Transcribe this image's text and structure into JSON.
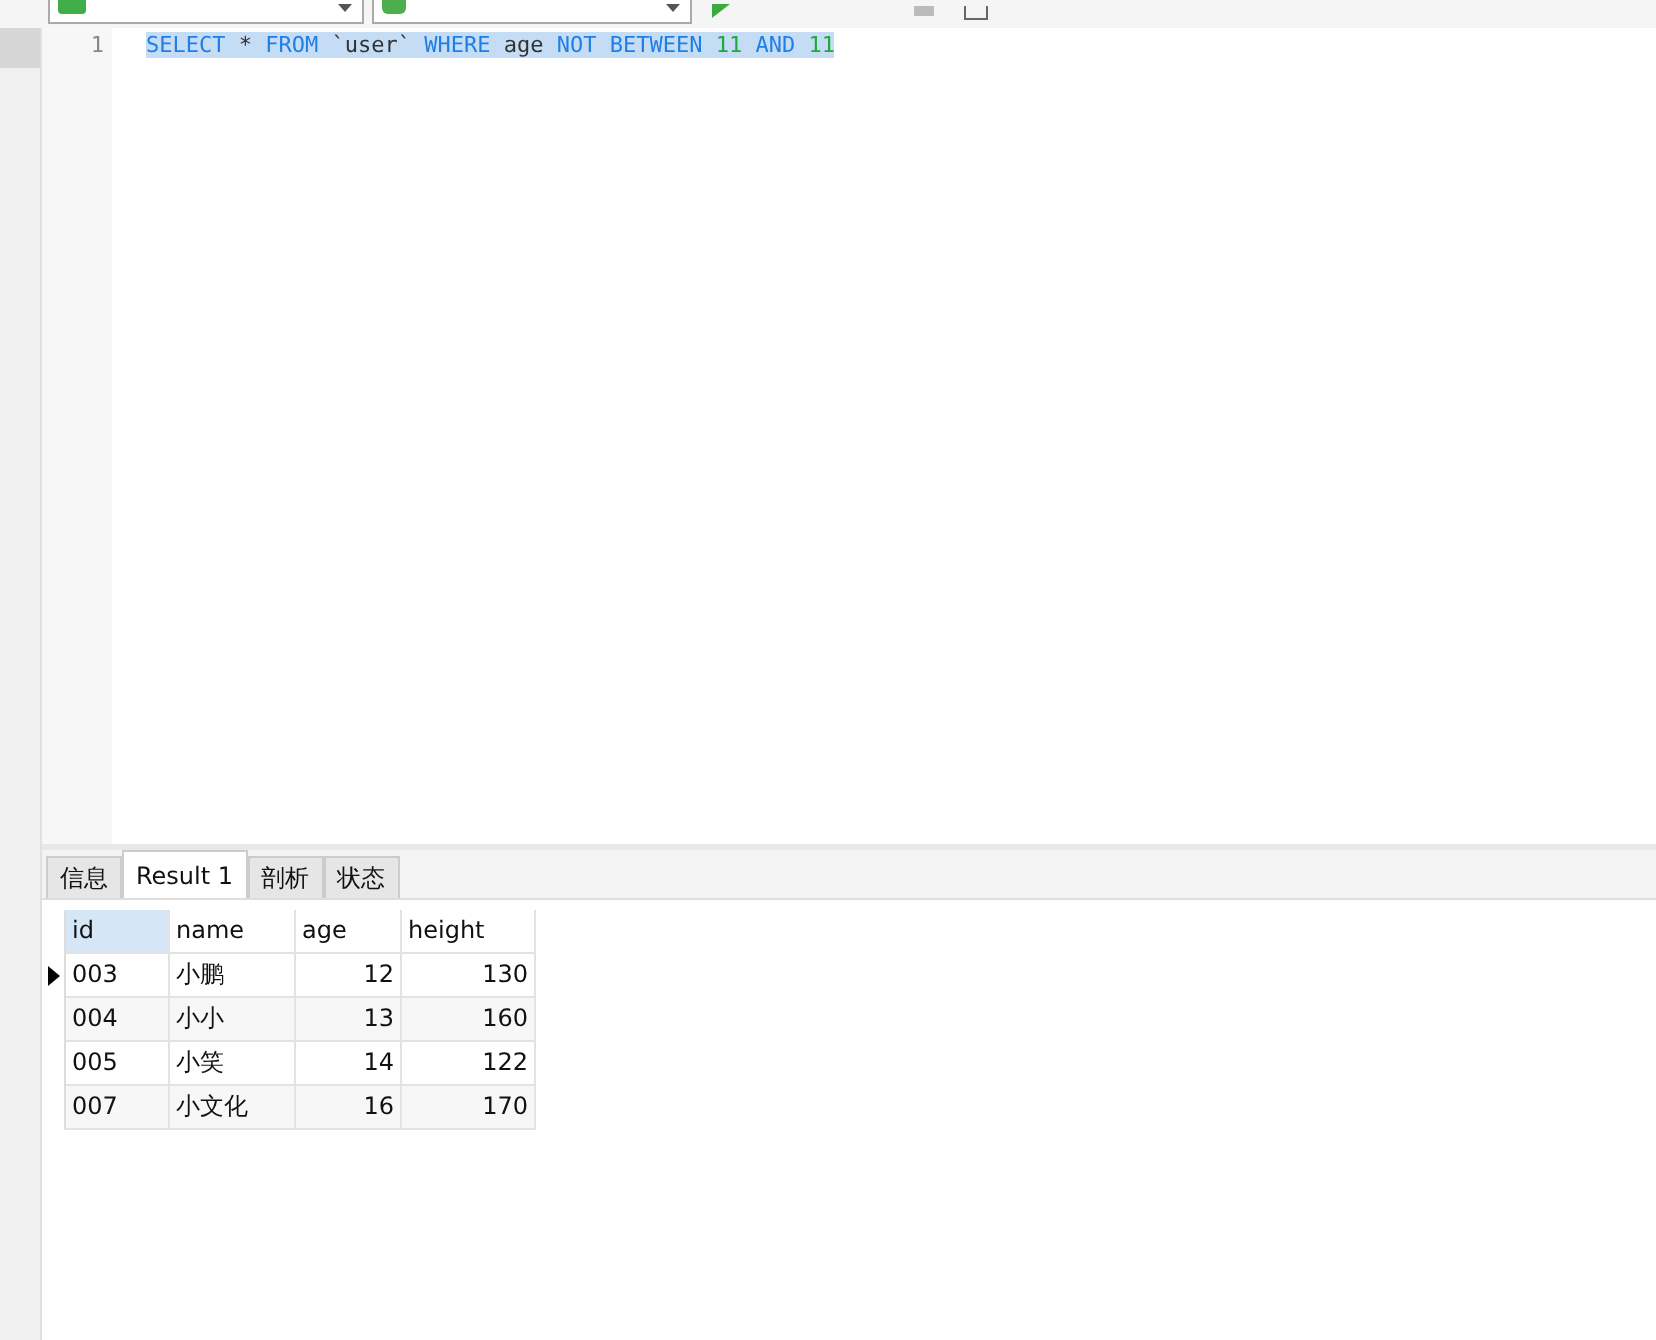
{
  "editor": {
    "lines": [
      {
        "number": "1",
        "selected": true,
        "tokens": [
          {
            "kind": "keyword",
            "text": "SELECT"
          },
          {
            "kind": "plain",
            "text": " * "
          },
          {
            "kind": "keyword",
            "text": "FROM"
          },
          {
            "kind": "plain",
            "text": " `user` "
          },
          {
            "kind": "keyword",
            "text": "WHERE"
          },
          {
            "kind": "plain",
            "text": " age "
          },
          {
            "kind": "keyword",
            "text": "NOT BETWEEN "
          },
          {
            "kind": "number",
            "text": "11"
          },
          {
            "kind": "keyword",
            "text": " AND "
          },
          {
            "kind": "number",
            "text": "11"
          }
        ]
      }
    ]
  },
  "tabs": [
    {
      "label": "信息",
      "selected": false
    },
    {
      "label": "Result 1",
      "selected": true
    },
    {
      "label": "剖析",
      "selected": false
    },
    {
      "label": "状态",
      "selected": false
    }
  ],
  "table": {
    "columns": [
      {
        "label": "id",
        "selected": true,
        "kind": "text"
      },
      {
        "label": "name",
        "selected": false,
        "kind": "text"
      },
      {
        "label": "age",
        "selected": false,
        "kind": "number"
      },
      {
        "label": "height",
        "selected": false,
        "kind": "number"
      }
    ],
    "rows": [
      {
        "current": true,
        "cells": [
          "003",
          "小鹏",
          "12",
          "130"
        ]
      },
      {
        "current": false,
        "cells": [
          "004",
          "小小",
          "13",
          "160"
        ]
      },
      {
        "current": false,
        "cells": [
          "005",
          "小笑",
          "14",
          "122"
        ]
      },
      {
        "current": false,
        "cells": [
          "007",
          "小文化",
          "16",
          "170"
        ]
      }
    ]
  }
}
